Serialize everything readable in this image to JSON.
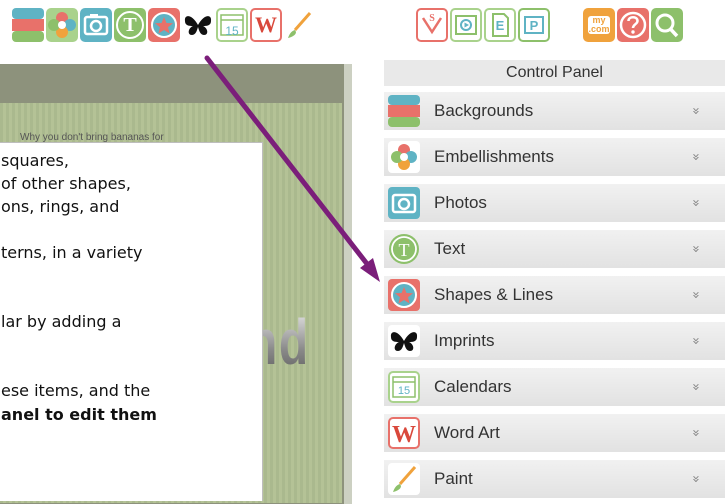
{
  "toolbar": {
    "calendar_day": "15",
    "word_art_letter": "W",
    "text_letter": "T",
    "my_com_top": "my",
    "my_com_bottom": ".com",
    "s_letter": "S",
    "e_letter": "E",
    "p_letter": "P"
  },
  "canvas": {
    "small_text": "Why you don't bring bananas for",
    "big_text": "nd"
  },
  "overlay": {
    "lines": [
      "squares,",
      "of other shapes,",
      "ons, rings, and",
      "",
      "terns, in a variety",
      "",
      "",
      "lar by adding a",
      "",
      "",
      "ese items, and the",
      "anel to edit them"
    ]
  },
  "panel": {
    "title": "Control Panel",
    "items": [
      {
        "label": "Backgrounds",
        "icon": "backgrounds-icon"
      },
      {
        "label": "Embellishments",
        "icon": "embellishments-icon"
      },
      {
        "label": "Photos",
        "icon": "camera-icon"
      },
      {
        "label": "Text",
        "icon": "text-icon"
      },
      {
        "label": "Shapes & Lines",
        "icon": "star-shape-icon"
      },
      {
        "label": "Imprints",
        "icon": "butterfly-icon"
      },
      {
        "label": "Calendars",
        "icon": "calendar-icon"
      },
      {
        "label": "Word Art",
        "icon": "word-art-icon"
      },
      {
        "label": "Paint",
        "icon": "paintbrush-icon"
      }
    ],
    "chevron": "»",
    "calendar_day": "15",
    "text_letter": "T",
    "word_art_letter": "W"
  },
  "colors": {
    "arrow": "#7b1e7a",
    "teal": "#5fb3c4",
    "green": "#8dc06b",
    "coral": "#e8716a",
    "orange": "#f0a23c"
  }
}
